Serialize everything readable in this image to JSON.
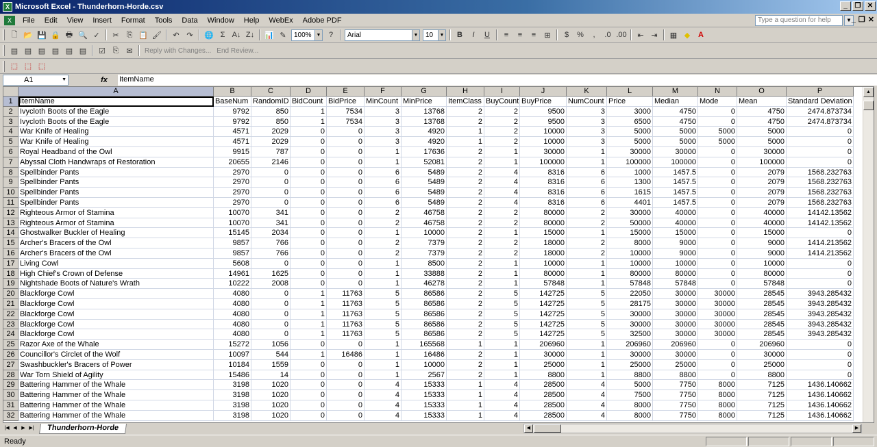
{
  "window": {
    "title": "Microsoft Excel - Thunderhorn-Horde.csv"
  },
  "menu": [
    "File",
    "Edit",
    "View",
    "Insert",
    "Format",
    "Tools",
    "Data",
    "Window",
    "Help",
    "WebEx",
    "Adobe PDF"
  ],
  "help": {
    "placeholder": "Type a question for help"
  },
  "toolbar": {
    "zoom": "100%",
    "font_name": "Arial",
    "font_size": "10",
    "reply_with_changes": "Reply with Changes...",
    "end_review": "End Review..."
  },
  "formula": {
    "cell_ref": "A1",
    "content": "ItemName"
  },
  "sheet": {
    "tab_name": "Thunderhorn-Horde",
    "selected_cell": "A1",
    "columns": [
      "A",
      "B",
      "C",
      "D",
      "E",
      "F",
      "G",
      "H",
      "I",
      "J",
      "K",
      "L",
      "M",
      "N",
      "O",
      "P"
    ],
    "rows": [
      [
        "ItemName",
        "BaseNum",
        "RandomID",
        "BidCount",
        "BidPrice",
        "MinCount",
        "MinPrice",
        "ItemClass",
        "BuyCount",
        "BuyPrice",
        "NumCount",
        "Price",
        "Median",
        "Mode",
        "Mean",
        "Standard Deviation"
      ],
      [
        "Ivycloth Boots of the Eagle",
        "9792",
        "850",
        "1",
        "7534",
        "3",
        "13768",
        "2",
        "2",
        "9500",
        "3",
        "3000",
        "4750",
        "0",
        "4750",
        "2474.873734"
      ],
      [
        "Ivycloth Boots of the Eagle",
        "9792",
        "850",
        "1",
        "7534",
        "3",
        "13768",
        "2",
        "2",
        "9500",
        "3",
        "6500",
        "4750",
        "0",
        "4750",
        "2474.873734"
      ],
      [
        "War Knife of Healing",
        "4571",
        "2029",
        "0",
        "0",
        "3",
        "4920",
        "1",
        "2",
        "10000",
        "3",
        "5000",
        "5000",
        "5000",
        "5000",
        "0"
      ],
      [
        "War Knife of Healing",
        "4571",
        "2029",
        "0",
        "0",
        "3",
        "4920",
        "1",
        "2",
        "10000",
        "3",
        "5000",
        "5000",
        "5000",
        "5000",
        "0"
      ],
      [
        "Royal Headband of the Owl",
        "9915",
        "787",
        "0",
        "0",
        "1",
        "17636",
        "2",
        "1",
        "30000",
        "1",
        "30000",
        "30000",
        "0",
        "30000",
        "0"
      ],
      [
        "Abyssal Cloth Handwraps of Restoration",
        "20655",
        "2146",
        "0",
        "0",
        "1",
        "52081",
        "2",
        "1",
        "100000",
        "1",
        "100000",
        "100000",
        "0",
        "100000",
        "0"
      ],
      [
        "Spellbinder Pants",
        "2970",
        "0",
        "0",
        "0",
        "6",
        "5489",
        "2",
        "4",
        "8316",
        "6",
        "1000",
        "1457.5",
        "0",
        "2079",
        "1568.232763"
      ],
      [
        "Spellbinder Pants",
        "2970",
        "0",
        "0",
        "0",
        "6",
        "5489",
        "2",
        "4",
        "8316",
        "6",
        "1300",
        "1457.5",
        "0",
        "2079",
        "1568.232763"
      ],
      [
        "Spellbinder Pants",
        "2970",
        "0",
        "0",
        "0",
        "6",
        "5489",
        "2",
        "4",
        "8316",
        "6",
        "1615",
        "1457.5",
        "0",
        "2079",
        "1568.232763"
      ],
      [
        "Spellbinder Pants",
        "2970",
        "0",
        "0",
        "0",
        "6",
        "5489",
        "2",
        "4",
        "8316",
        "6",
        "4401",
        "1457.5",
        "0",
        "2079",
        "1568.232763"
      ],
      [
        "Righteous Armor of Stamina",
        "10070",
        "341",
        "0",
        "0",
        "2",
        "46758",
        "2",
        "2",
        "80000",
        "2",
        "30000",
        "40000",
        "0",
        "40000",
        "14142.13562"
      ],
      [
        "Righteous Armor of Stamina",
        "10070",
        "341",
        "0",
        "0",
        "2",
        "46758",
        "2",
        "2",
        "80000",
        "2",
        "50000",
        "40000",
        "0",
        "40000",
        "14142.13562"
      ],
      [
        "Ghostwalker Buckler of Healing",
        "15145",
        "2034",
        "0",
        "0",
        "1",
        "10000",
        "2",
        "1",
        "15000",
        "1",
        "15000",
        "15000",
        "0",
        "15000",
        "0"
      ],
      [
        "Archer's Bracers of the Owl",
        "9857",
        "766",
        "0",
        "0",
        "2",
        "7379",
        "2",
        "2",
        "18000",
        "2",
        "8000",
        "9000",
        "0",
        "9000",
        "1414.213562"
      ],
      [
        "Archer's Bracers of the Owl",
        "9857",
        "766",
        "0",
        "0",
        "2",
        "7379",
        "2",
        "2",
        "18000",
        "2",
        "10000",
        "9000",
        "0",
        "9000",
        "1414.213562"
      ],
      [
        "Living Cowl",
        "5608",
        "0",
        "0",
        "0",
        "1",
        "8500",
        "2",
        "1",
        "10000",
        "1",
        "10000",
        "10000",
        "0",
        "10000",
        "0"
      ],
      [
        "High Chief's Crown of Defense",
        "14961",
        "1625",
        "0",
        "0",
        "1",
        "33888",
        "2",
        "1",
        "80000",
        "1",
        "80000",
        "80000",
        "0",
        "80000",
        "0"
      ],
      [
        "Nightshade Boots of Nature's Wrath",
        "10222",
        "2008",
        "0",
        "0",
        "1",
        "46278",
        "2",
        "1",
        "57848",
        "1",
        "57848",
        "57848",
        "0",
        "57848",
        "0"
      ],
      [
        "Blackforge Cowl",
        "4080",
        "0",
        "1",
        "11763",
        "5",
        "86586",
        "2",
        "5",
        "142725",
        "5",
        "22050",
        "30000",
        "30000",
        "28545",
        "3943.285432"
      ],
      [
        "Blackforge Cowl",
        "4080",
        "0",
        "1",
        "11763",
        "5",
        "86586",
        "2",
        "5",
        "142725",
        "5",
        "28175",
        "30000",
        "30000",
        "28545",
        "3943.285432"
      ],
      [
        "Blackforge Cowl",
        "4080",
        "0",
        "1",
        "11763",
        "5",
        "86586",
        "2",
        "5",
        "142725",
        "5",
        "30000",
        "30000",
        "30000",
        "28545",
        "3943.285432"
      ],
      [
        "Blackforge Cowl",
        "4080",
        "0",
        "1",
        "11763",
        "5",
        "86586",
        "2",
        "5",
        "142725",
        "5",
        "30000",
        "30000",
        "30000",
        "28545",
        "3943.285432"
      ],
      [
        "Blackforge Cowl",
        "4080",
        "0",
        "1",
        "11763",
        "5",
        "86586",
        "2",
        "5",
        "142725",
        "5",
        "32500",
        "30000",
        "30000",
        "28545",
        "3943.285432"
      ],
      [
        "Razor Axe of the Whale",
        "15272",
        "1056",
        "0",
        "0",
        "1",
        "165568",
        "1",
        "1",
        "206960",
        "1",
        "206960",
        "206960",
        "0",
        "206960",
        "0"
      ],
      [
        "Councillor's Circlet of the Wolf",
        "10097",
        "544",
        "1",
        "16486",
        "1",
        "16486",
        "2",
        "1",
        "30000",
        "1",
        "30000",
        "30000",
        "0",
        "30000",
        "0"
      ],
      [
        "Swashbuckler's Bracers of Power",
        "10184",
        "1559",
        "0",
        "0",
        "1",
        "10000",
        "2",
        "1",
        "25000",
        "1",
        "25000",
        "25000",
        "0",
        "25000",
        "0"
      ],
      [
        "War Torn Shield of Agility",
        "15486",
        "14",
        "0",
        "0",
        "1",
        "2567",
        "2",
        "1",
        "8800",
        "1",
        "8800",
        "8800",
        "0",
        "8800",
        "0"
      ],
      [
        "Battering Hammer of the Whale",
        "3198",
        "1020",
        "0",
        "0",
        "4",
        "15333",
        "1",
        "4",
        "28500",
        "4",
        "5000",
        "7750",
        "8000",
        "7125",
        "1436.140662"
      ],
      [
        "Battering Hammer of the Whale",
        "3198",
        "1020",
        "0",
        "0",
        "4",
        "15333",
        "1",
        "4",
        "28500",
        "4",
        "7500",
        "7750",
        "8000",
        "7125",
        "1436.140662"
      ],
      [
        "Battering Hammer of the Whale",
        "3198",
        "1020",
        "0",
        "0",
        "4",
        "15333",
        "1",
        "4",
        "28500",
        "4",
        "8000",
        "7750",
        "8000",
        "7125",
        "1436.140662"
      ],
      [
        "Battering Hammer of the Whale",
        "3198",
        "1020",
        "0",
        "0",
        "4",
        "15333",
        "1",
        "4",
        "28500",
        "4",
        "8000",
        "7750",
        "8000",
        "7125",
        "1436.140662"
      ]
    ]
  },
  "status": {
    "text": "Ready"
  }
}
